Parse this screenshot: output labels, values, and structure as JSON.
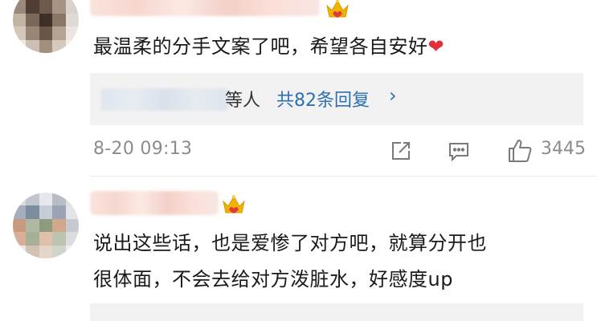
{
  "comments": [
    {
      "text": "最温柔的分手文案了吧，希望各自安好",
      "emoji": "❤",
      "reply": {
        "others_label": "等人",
        "total_label": "共82条回复",
        "chevron": "›"
      },
      "timestamp": "8-20 09:13",
      "like_count": "3445",
      "icons": [
        "share-icon",
        "comment-icon",
        "thumbs-up-icon"
      ]
    },
    {
      "text_line1": "说出这些话，也是爱惨了对方吧，就算分开也",
      "text_line2": "很体面，不会去给对方泼脏水，好感度up"
    }
  ],
  "colors": {
    "link_blue": "#2f6fb3",
    "meta_gray": "#8c8c8c",
    "heart_red": "#e0303a",
    "crown_gold": "#f2b300",
    "reply_bg": "#f2f2f2"
  }
}
